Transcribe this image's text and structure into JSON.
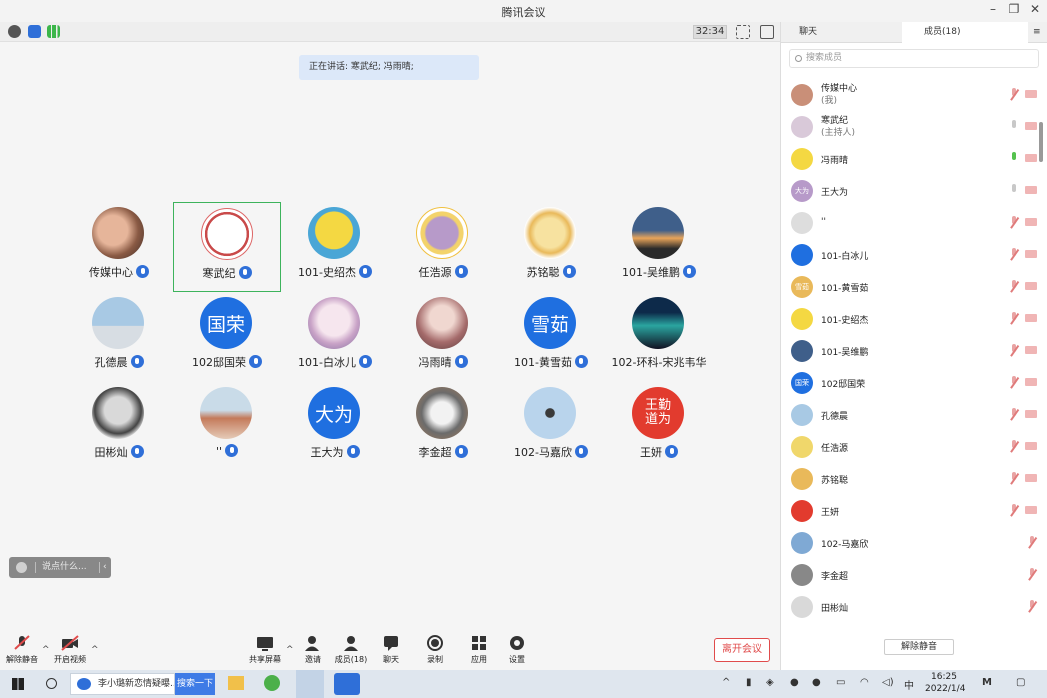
{
  "window": {
    "title": "腾讯会议"
  },
  "toolbar": {
    "timer": "32:34"
  },
  "speaking": {
    "text": "正在讲话: 寒武纪; 冯雨晴;"
  },
  "participants": [
    {
      "name": "传媒中心"
    },
    {
      "name": "寒武纪"
    },
    {
      "name": "101-史绍杰"
    },
    {
      "name": "任浩源"
    },
    {
      "name": "苏铭聪"
    },
    {
      "name": "101-吴维鹏"
    },
    {
      "name": "孔德晨"
    },
    {
      "name": "102邸国荣",
      "initials": "国荣"
    },
    {
      "name": "101-白冰儿"
    },
    {
      "name": "冯雨晴"
    },
    {
      "name": "101-黄雪茹",
      "initials": "雪茹"
    },
    {
      "name": "102-环科-宋兆韦华"
    },
    {
      "name": "田彬灿"
    },
    {
      "name": "''"
    },
    {
      "name": "王大为",
      "initials": "大为"
    },
    {
      "name": "李金超"
    },
    {
      "name": "102-马嘉欣"
    },
    {
      "name": "王妍",
      "seal": "王勤道为"
    }
  ],
  "chat_input": {
    "placeholder": "说点什么..."
  },
  "bottombar": {
    "unmute": "解除静音",
    "video": "开启视频",
    "share": "共享屏幕",
    "invite": "邀请",
    "members": "成员(18)",
    "chat": "聊天",
    "record": "录制",
    "apps": "应用",
    "settings": "设置",
    "leave": "离开会议"
  },
  "side": {
    "tab_chat": "聊天",
    "tab_members": "成员(18)",
    "search_placeholder": "搜索成员",
    "members": [
      {
        "name": "传媒中心",
        "sub": "(我)"
      },
      {
        "name": "寒武纪",
        "sub": "(主持人)"
      },
      {
        "name": "冯雨晴"
      },
      {
        "name": "王大为",
        "initials": "大为"
      },
      {
        "name": "''"
      },
      {
        "name": "101-白冰儿"
      },
      {
        "name": "101-黄雪茹",
        "initials": "雪茹"
      },
      {
        "name": "101-史绍杰"
      },
      {
        "name": "101-吴维鹏"
      },
      {
        "name": "102邸国荣",
        "initials": "国荣"
      },
      {
        "name": "孔德晨"
      },
      {
        "name": "任浩源"
      },
      {
        "name": "苏铭聪"
      },
      {
        "name": "王妍"
      },
      {
        "name": "102-马嘉欣"
      },
      {
        "name": "李金超"
      },
      {
        "name": "田彬灿"
      }
    ],
    "unmute_all": "解除静音"
  },
  "taskbar": {
    "search_text": "李小璐新恋情疑曝...",
    "search_button": "搜索一下",
    "ime": "中",
    "time": "16:25",
    "date": "2022/1/4"
  }
}
